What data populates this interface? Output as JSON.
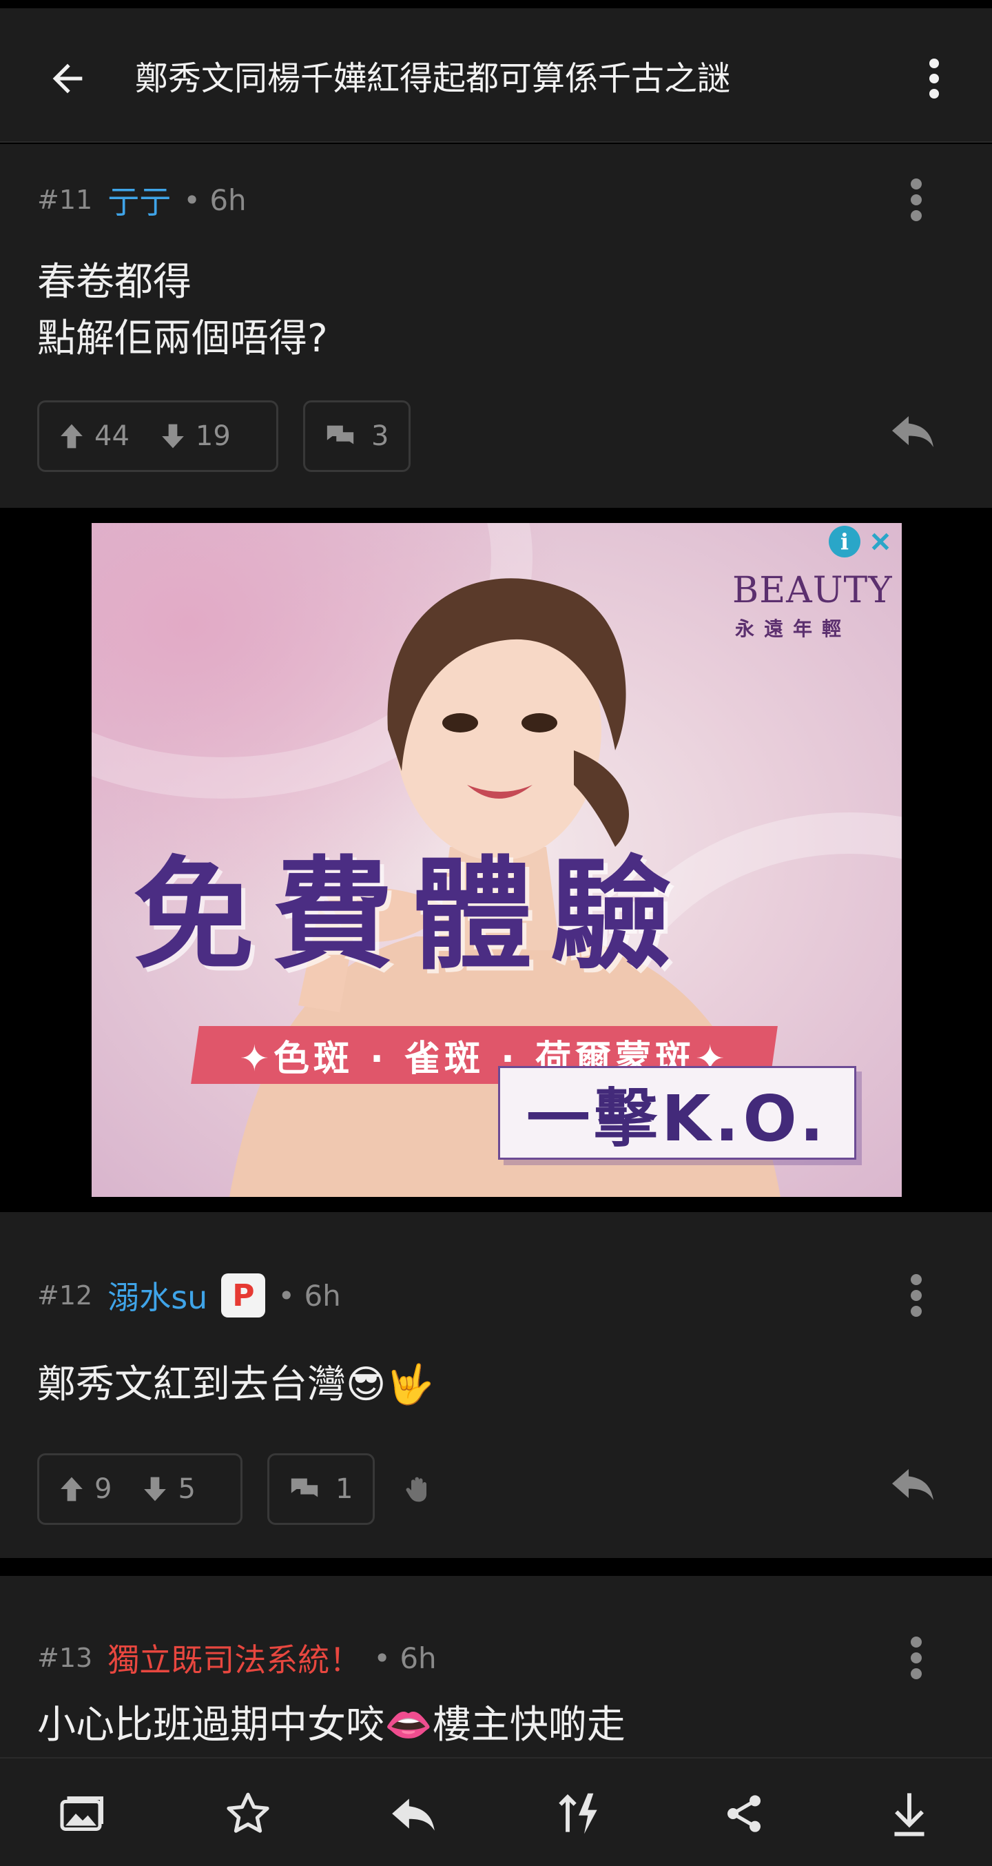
{
  "header": {
    "title": "鄭秀文同楊千嬅紅得起都可算係千古之謎",
    "back_icon": "arrow-left-icon",
    "more_icon": "more-vertical-icon"
  },
  "posts": [
    {
      "floor": "#11",
      "author": "亍亍",
      "author_color": "#3fa4e8",
      "time": "• 6h",
      "body": [
        "春卷都得",
        "點解佢兩個唔得?"
      ],
      "upvotes": "44",
      "downvotes": "19",
      "comments": "3"
    },
    {
      "floor": "#12",
      "author": "溺水su",
      "author_color": "#3fa4e8",
      "badge": "P",
      "time": "• 6h",
      "body": [
        "鄭秀文紅到去台灣😎🤟"
      ],
      "upvotes": "9",
      "downvotes": "5",
      "comments": "1"
    },
    {
      "floor": "#13",
      "author": "獨立既司法系統！",
      "author_color": "#e8473f",
      "time": "• 6h",
      "body": [
        "小心比班過期中女咬👄樓主快啲走"
      ]
    }
  ],
  "ad": {
    "brand_name": "BEAUTY",
    "brand_sub": "永遠年輕",
    "headline": "免費體驗",
    "ribbon": "✦色斑 · 雀斑 · 荷爾蒙斑✦",
    "tagline": "一擊K.O.",
    "info_label": "i"
  },
  "bottom_toolbar": [
    "image-gallery-icon",
    "star-icon",
    "reply-icon",
    "sort-lightning-icon",
    "share-icon",
    "download-icon"
  ]
}
